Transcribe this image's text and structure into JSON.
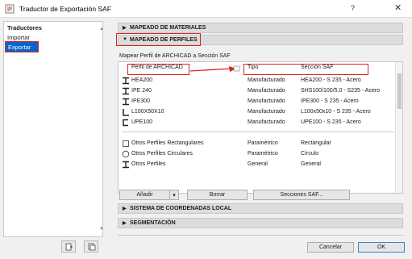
{
  "window": {
    "title": "Traductor de Exportación SAF",
    "help": "?",
    "close": "✕"
  },
  "sidebar": {
    "header": "Traductores",
    "items": [
      {
        "label": "Importar"
      },
      {
        "label": "Exportar",
        "selected": true
      }
    ]
  },
  "sections": {
    "materials": "MAPEADO DE MATERIALES",
    "profiles": "MAPEADO DE PERFILES",
    "coords": "SISTEMA DE COORDENADAS LOCAL",
    "segmentation": "SEGMENTACIÓN"
  },
  "profiles_panel": {
    "caption": "Mapear Perfil de ARCHICAD a Sección SAF",
    "columns": {
      "profile": "Perfil de ARCHICAD",
      "type": "Tipo",
      "section": "Sección SAF"
    },
    "rows": [
      {
        "profile": "HEA200",
        "type": "Manufacturado",
        "section": "HEA200 - S 235 - Acero"
      },
      {
        "profile": "IPE 240",
        "type": "Manufacturado",
        "section": "SHS100/100/5.0 - S235 - Acero"
      },
      {
        "profile": "IPE300",
        "type": "Manufacturado",
        "section": "IPE300 - S 235 - Acero"
      },
      {
        "profile": "L100X50X10",
        "type": "Manufacturado",
        "section": "L100x50x10 - S 235 - Acero"
      },
      {
        "profile": "UPE100",
        "type": "Manufacturado",
        "section": "UPE100 - S 235 - Acero"
      }
    ],
    "other_rows": [
      {
        "profile": "Otros Perfiles Rectangulares",
        "type": "Paramétrico",
        "section": "Rectangular"
      },
      {
        "profile": "Otros Perfiles Circulares",
        "type": "Paramétrico",
        "section": "Círculo"
      },
      {
        "profile": "Otros Perfiles",
        "type": "General",
        "section": "General"
      }
    ],
    "buttons": {
      "add": "Añadir",
      "delete": "Borrar",
      "sections": "Secciones SAF..."
    }
  },
  "footer": {
    "cancel": "Cancelar",
    "ok": "OK"
  },
  "colors": {
    "selection": "#0a64c8",
    "highlight": "#e02020"
  }
}
